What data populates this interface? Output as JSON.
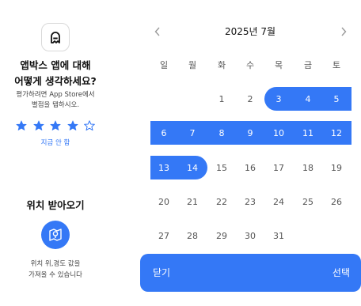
{
  "rating_prompt": {
    "title_line1": "앱박스 앱에 대해",
    "title_line2": "어떻게 생각하세요?",
    "subtitle_line1": "평가하려면 App Store에서",
    "subtitle_line2": "별점을 탭하시오.",
    "stars": [
      true,
      true,
      true,
      true,
      false
    ],
    "later_label": "지금 안 함"
  },
  "location_prompt": {
    "title": "위치 받아오기",
    "desc_line1": "위치 위,경도 값을",
    "desc_line2": "가져올 수 있습니다"
  },
  "calendar": {
    "month_title": "2025년 7월",
    "weekdays": [
      "일",
      "월",
      "화",
      "수",
      "목",
      "금",
      "토"
    ],
    "weeks": [
      [
        "",
        "",
        "1",
        "2",
        "3",
        "4",
        "5"
      ],
      [
        "6",
        "7",
        "8",
        "9",
        "10",
        "11",
        "12"
      ],
      [
        "13",
        "14",
        "15",
        "16",
        "17",
        "18",
        "19"
      ],
      [
        "20",
        "21",
        "22",
        "23",
        "24",
        "25",
        "26"
      ],
      [
        "27",
        "28",
        "29",
        "30",
        "31",
        "",
        ""
      ]
    ],
    "range_start": "3",
    "range_end": "14"
  },
  "actions": {
    "close_label": "닫기",
    "select_label": "선택"
  },
  "colors": {
    "accent": "#3478f6",
    "star_empty": "#3478f6"
  }
}
